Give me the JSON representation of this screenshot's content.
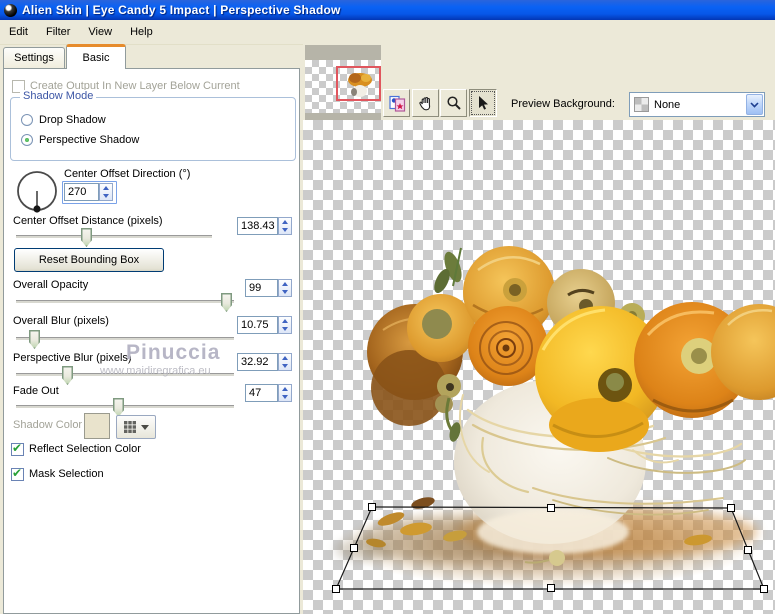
{
  "window": {
    "title": "Alien Skin | Eye Candy 5 Impact | Perspective Shadow"
  },
  "menu": {
    "items": [
      "Edit",
      "Filter",
      "View",
      "Help"
    ]
  },
  "tabs": {
    "settings": "Settings",
    "basic": "Basic"
  },
  "panel": {
    "new_layer_label": "Create Output In New Layer Below Current",
    "shadow_mode": {
      "title": "Shadow Mode",
      "options": [
        "Drop Shadow",
        "Perspective Shadow"
      ],
      "selected": "Perspective Shadow"
    },
    "direction": {
      "label": "Center Offset Direction (°)",
      "value": "270"
    },
    "distance": {
      "label": "Center Offset Distance (pixels)",
      "value": "138.43"
    },
    "reset_button_label": "Reset Bounding Box",
    "opacity": {
      "label": "Overall Opacity",
      "value": "99"
    },
    "blur": {
      "label": "Overall Blur (pixels)",
      "value": "10.75"
    },
    "perspective_blur": {
      "label": "Perspective Blur (pixels)",
      "value": "32.92"
    },
    "fade_out": {
      "label": "Fade Out",
      "value": "47"
    },
    "shadow_color_label": "Shadow Color",
    "reflect_label": "Reflect Selection Color",
    "mask_label": "Mask Selection",
    "watermark": {
      "name": "Pinuccia",
      "url": "www.maidiregrafica.eu"
    }
  },
  "preview": {
    "background_label": "Preview Background:",
    "background_value": "None"
  },
  "colors": {
    "titlebar_blue": "#0a62f4",
    "chrome_beige": "#ece9d8",
    "active_tab_accent": "#e68b2c",
    "view_rect_red": "#e0565e",
    "shadow_swatch_beige": "#e9e3cc"
  }
}
